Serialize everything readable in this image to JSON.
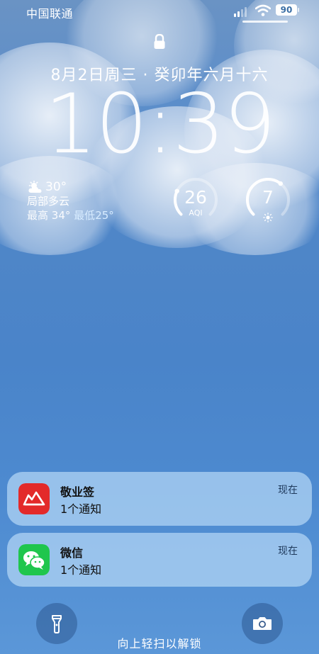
{
  "status_bar": {
    "carrier": "中国联通",
    "battery": "90",
    "icons": [
      "signal-icon",
      "wifi-icon",
      "battery-icon"
    ]
  },
  "lock_icon": "lock-icon",
  "date": "8月2日周三 · 癸卯年六月十六",
  "time": "10:39",
  "weather": {
    "icon": "partly-cloudy-icon",
    "temperature": "30°",
    "condition": "局部多云",
    "high_label": "最高",
    "high": "34°",
    "low_label": "最低",
    "low": "25°"
  },
  "aqi_widget": {
    "value": "26",
    "label": "AQI",
    "level": 0.26
  },
  "uv_widget": {
    "value": "7",
    "icon": "sun-icon",
    "level": 0.64
  },
  "notifications": [
    {
      "app": "敬业签",
      "body": "1个通知",
      "time": "现在",
      "icon": "jingyeqian-app-icon",
      "color": "#e32a2a"
    },
    {
      "app": "微信",
      "body": "1个通知",
      "time": "现在",
      "icon": "wechat-app-icon",
      "color": "#1fc64d"
    }
  ],
  "bottom": {
    "flashlight_icon": "flashlight-icon",
    "camera_icon": "camera-icon",
    "unlock_hint": "向上轻扫以解锁"
  }
}
